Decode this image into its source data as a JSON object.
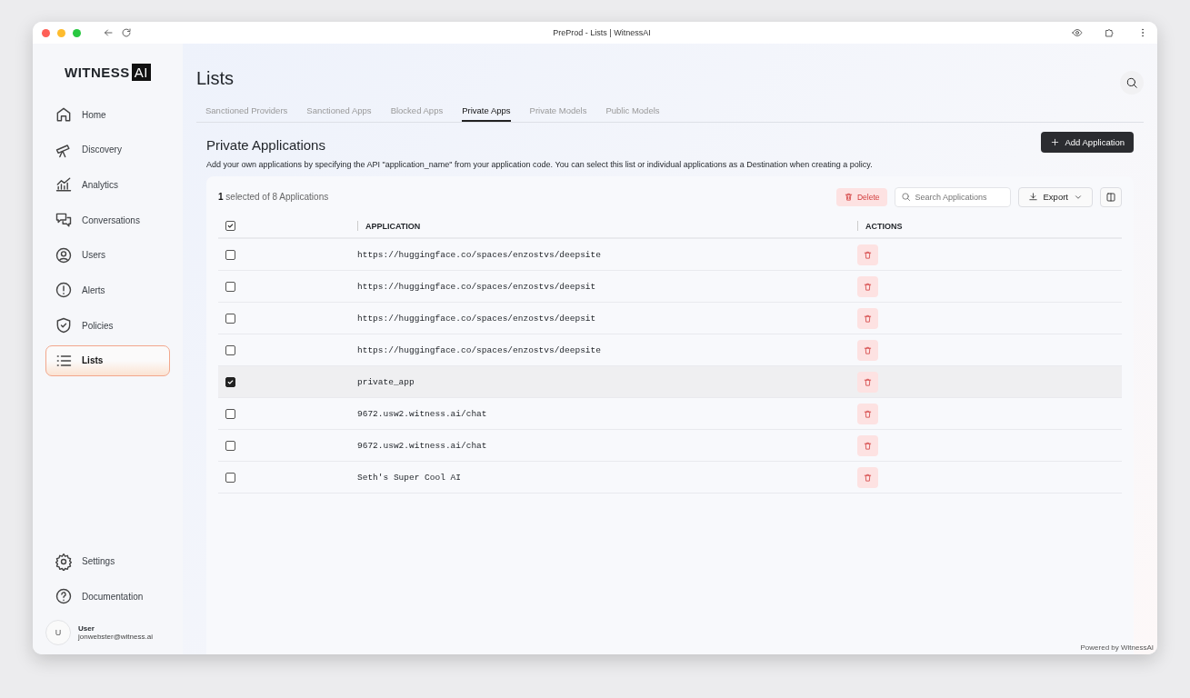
{
  "browser": {
    "title": "PreProd - Lists | WitnessAI"
  },
  "sidebar": {
    "logo_text": "WITNESS",
    "logo_badge": "AI",
    "items": [
      {
        "label": "Home",
        "selected": false
      },
      {
        "label": "Discovery",
        "selected": false
      },
      {
        "label": "Analytics",
        "selected": false
      },
      {
        "label": "Conversations",
        "selected": false
      },
      {
        "label": "Users",
        "selected": false
      },
      {
        "label": "Alerts",
        "selected": false
      },
      {
        "label": "Policies",
        "selected": false
      },
      {
        "label": "Lists",
        "selected": true
      }
    ],
    "bottom_items": [
      {
        "label": "Settings",
        "selected": false
      },
      {
        "label": "Documentation",
        "selected": false
      }
    ],
    "user": {
      "initial": "U",
      "name": "User",
      "email": "jonwebster@witness.ai"
    }
  },
  "page": {
    "title": "Lists",
    "tabs": [
      {
        "label": "Sanctioned Providers",
        "selected": false
      },
      {
        "label": "Sanctioned Apps",
        "selected": false
      },
      {
        "label": "Blocked Apps",
        "selected": false
      },
      {
        "label": "Private Apps",
        "selected": true
      },
      {
        "label": "Private Models",
        "selected": false
      },
      {
        "label": "Public Models",
        "selected": false
      }
    ],
    "section_title": "Private Applications",
    "description": "Add your own applications by specifying the API \"application_name\" from your application code. You can select this list or individual applications as a Destination when creating a policy.",
    "add_button": "Add Application"
  },
  "table": {
    "status": "**1** selected of 8 Applications",
    "delete_button": "Delete",
    "search": {
      "placeholder": "Search Applications"
    },
    "export_button": "Export",
    "header_checked": true,
    "columns": [
      "APPLICATION",
      "ACTIONS"
    ],
    "rows": [
      {
        "application": "https://huggingface.co/spaces/enzostvs/deepsite",
        "selected": false
      },
      {
        "application": "https://huggingface.co/spaces/enzostvs/deepsit",
        "selected": false
      },
      {
        "application": "https://huggingface.co/spaces/enzostvs/deepsit",
        "selected": false
      },
      {
        "application": "https://huggingface.co/spaces/enzostvs/deepsite",
        "selected": false
      },
      {
        "application": "private_app",
        "selected": true
      },
      {
        "application": "9672.usw2.witness.ai/chat",
        "selected": false
      },
      {
        "application": "9672.usw2.witness.ai/chat",
        "selected": false
      },
      {
        "application": "Seth's Super Cool AI",
        "selected": false
      }
    ]
  },
  "footer": "Powered by WitnessAI"
}
